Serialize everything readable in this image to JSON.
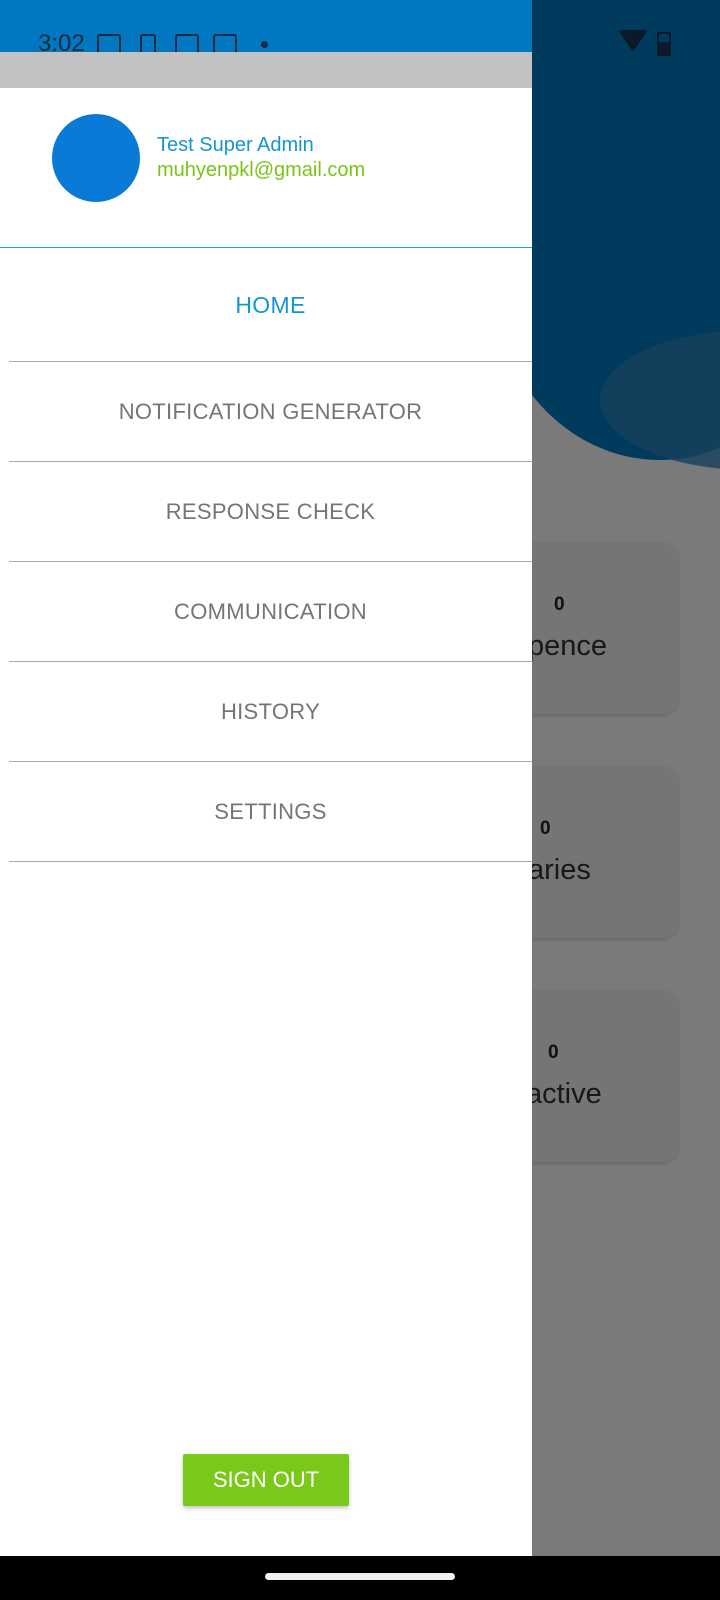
{
  "status_bar": {
    "time": "3:02",
    "icons": [
      "linkedin-icon",
      "download-icon",
      "calendar-icon",
      "calendar-icon",
      "dot-icon",
      "wifi-icon",
      "battery-icon"
    ]
  },
  "background": {
    "cards": [
      {
        "count": "0",
        "label_fragment": "pence"
      },
      {
        "count": "0",
        "label_fragment": "aries"
      },
      {
        "count": "0",
        "label_fragment": "active"
      }
    ]
  },
  "drawer": {
    "user": {
      "name": "Test Super Admin",
      "email": "muhyenpkl@gmail.com"
    },
    "menu": [
      {
        "label": "HOME",
        "active": true
      },
      {
        "label": "NOTIFICATION GENERATOR",
        "active": false
      },
      {
        "label": "RESPONSE CHECK",
        "active": false
      },
      {
        "label": "COMMUNICATION",
        "active": false
      },
      {
        "label": "HISTORY",
        "active": false
      },
      {
        "label": "SETTINGS",
        "active": false
      }
    ],
    "sign_out_label": "SIGN OUT"
  },
  "colors": {
    "primary_blue": "#0077c0",
    "accent_blue": "#1495d4",
    "accent_green": "#7cc318",
    "menu_text": "#757575"
  }
}
